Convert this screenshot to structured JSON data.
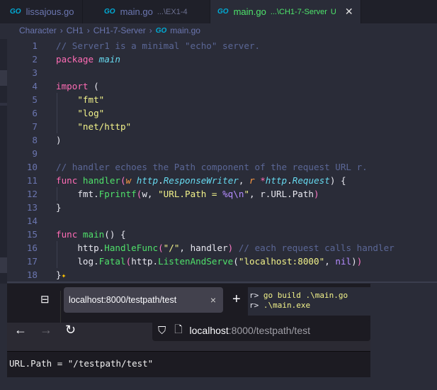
{
  "tabs": [
    {
      "label": "lissajous.go",
      "path": "",
      "icon": "go-file-icon"
    },
    {
      "label": "main.go",
      "path": "...\\EX1-4",
      "icon": "go-file-icon"
    },
    {
      "label": "main.go",
      "path": "...\\CH1-7-Server",
      "status": "U",
      "icon": "go-file-icon",
      "active": true
    }
  ],
  "go_icon_text": "GO",
  "breadcrumb": [
    "Character",
    "CH1",
    "CH1-7-Server",
    "main.go"
  ],
  "code": [
    [
      [
        "// Server1 is a minimal \"echo\" server.",
        "comment"
      ]
    ],
    [
      [
        "package ",
        "keyword"
      ],
      [
        "main",
        "pkgname"
      ]
    ],
    [],
    [
      [
        "import ",
        "keyword"
      ],
      [
        "(",
        "punct"
      ]
    ],
    [
      [
        "    ",
        "plain"
      ],
      [
        "\"fmt\"",
        "string"
      ]
    ],
    [
      [
        "    ",
        "plain"
      ],
      [
        "\"log\"",
        "string"
      ]
    ],
    [
      [
        "    ",
        "plain"
      ],
      [
        "\"net/http\"",
        "string"
      ]
    ],
    [
      [
        ")",
        "punct"
      ]
    ],
    [],
    [
      [
        "// handler echoes the Path component of the request URL r.",
        "comment"
      ]
    ],
    [
      [
        "func ",
        "keyword"
      ],
      [
        "handler",
        "func"
      ],
      [
        "(",
        "paren"
      ],
      [
        "w ",
        "param"
      ],
      [
        "http",
        "type"
      ],
      [
        ".",
        "plain"
      ],
      [
        "ResponseWriter",
        "type"
      ],
      [
        ", ",
        "plain"
      ],
      [
        "r ",
        "param"
      ],
      [
        "*",
        "keyword"
      ],
      [
        "http",
        "type"
      ],
      [
        ".",
        "plain"
      ],
      [
        "Request",
        "type"
      ],
      [
        ") {",
        "plain"
      ]
    ],
    [
      [
        "    fmt.",
        "plain"
      ],
      [
        "Fprintf",
        "func"
      ],
      [
        "(",
        "paren"
      ],
      [
        "w, ",
        "plain"
      ],
      [
        "\"URL.Path = ",
        "string"
      ],
      [
        "%q\\n",
        "const"
      ],
      [
        "\"",
        "string"
      ],
      [
        ", r.URL.Path",
        "plain"
      ],
      [
        ")",
        "paren"
      ]
    ],
    [
      [
        "}",
        "plain"
      ]
    ],
    [],
    [
      [
        "func ",
        "keyword"
      ],
      [
        "main",
        "func"
      ],
      [
        "() {",
        "plain"
      ]
    ],
    [
      [
        "    http.",
        "plain"
      ],
      [
        "HandleFunc",
        "func"
      ],
      [
        "(",
        "paren"
      ],
      [
        "\"/\"",
        "string"
      ],
      [
        ", handler",
        "plain"
      ],
      [
        ")",
        "paren"
      ],
      [
        " // each request calls handler",
        "comment"
      ]
    ],
    [
      [
        "    log.",
        "plain"
      ],
      [
        "Fatal",
        "func"
      ],
      [
        "(",
        "paren"
      ],
      [
        "http.",
        "plain"
      ],
      [
        "ListenAndServe",
        "func"
      ],
      [
        "(",
        "plain"
      ],
      [
        "\"localhost:8000\"",
        "string"
      ],
      [
        ", ",
        "plain"
      ],
      [
        "nil",
        "const"
      ],
      [
        ")",
        "plain"
      ],
      [
        ")",
        "paren"
      ]
    ],
    [
      [
        "}",
        "plain"
      ],
      [
        "✦",
        "sparkle"
      ]
    ]
  ],
  "terminal": {
    "line1_prefix": "r> ",
    "line1_cmd": "go build .\\main.go",
    "line2_prefix": "r> ",
    "line2_cmd": ".\\main.exe"
  },
  "browser": {
    "tab_title": "localhost:8000/testpath/test",
    "tab_close": "×",
    "new_tab": "+",
    "url_host": "localhost",
    "url_rest": ":8000/testpath/test",
    "page_output": "URL.Path = \"/testpath/test\""
  }
}
